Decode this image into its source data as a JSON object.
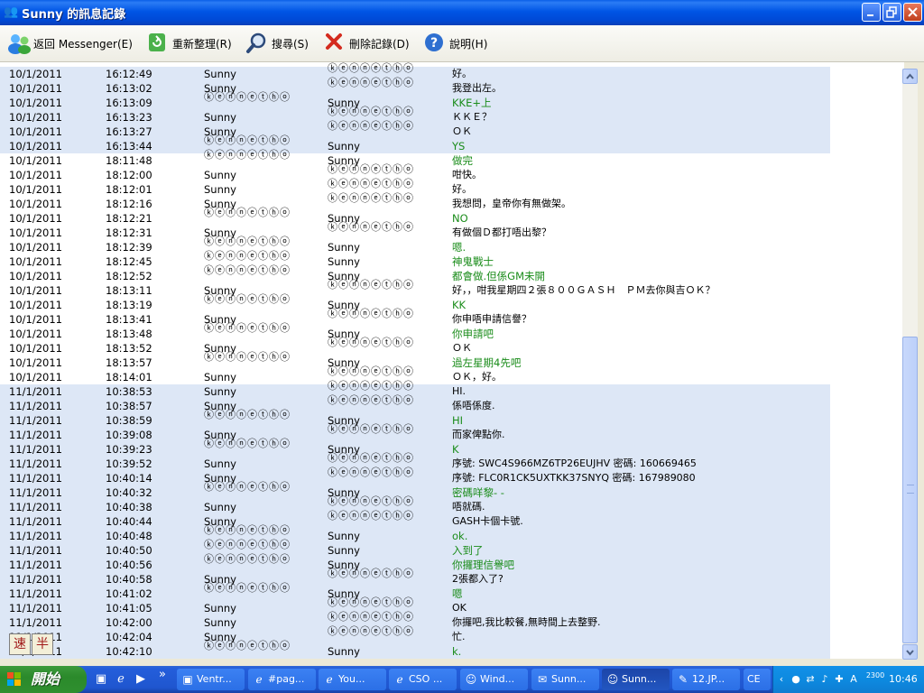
{
  "window": {
    "title": "Sunny 的訊息記錄",
    "icon": "people-icon",
    "controls": [
      "minimize",
      "restore",
      "close"
    ]
  },
  "toolbar": {
    "back_label": "返回 Messenger(E)",
    "refresh_label": "重新整理(R)",
    "search_label": "搜尋(S)",
    "delete_label": "刪除記錄(D)",
    "help_label": "說明(H)"
  },
  "log_rows": [
    {
      "date": "10/1/2011",
      "time": "16:12:49",
      "from": "Sunny",
      "to": "ⓚⓔⓝⓝⓔⓣⓗⓞ",
      "msg": "好。",
      "color": "black",
      "hl": true
    },
    {
      "date": "10/1/2011",
      "time": "16:13:02",
      "from": "Sunny",
      "to": "ⓚⓔⓝⓝⓔⓣⓗⓞ",
      "msg": "我登出左。",
      "color": "black",
      "hl": true
    },
    {
      "date": "10/1/2011",
      "time": "16:13:09",
      "from": "ⓚⓔⓝⓝⓔⓣⓗⓞ",
      "to": "Sunny",
      "msg": "KKE+上",
      "color": "green",
      "hl": true
    },
    {
      "date": "10/1/2011",
      "time": "16:13:23",
      "from": "Sunny",
      "to": "ⓚⓔⓝⓝⓔⓣⓗⓞ",
      "msg": "ＫＫＥ？",
      "color": "black",
      "hl": true
    },
    {
      "date": "10/1/2011",
      "time": "16:13:27",
      "from": "Sunny",
      "to": "ⓚⓔⓝⓝⓔⓣⓗⓞ",
      "msg": "ＯＫ",
      "color": "black",
      "hl": true
    },
    {
      "date": "10/1/2011",
      "time": "16:13:44",
      "from": "ⓚⓔⓝⓝⓔⓣⓗⓞ",
      "to": "Sunny",
      "msg": "YS",
      "color": "green",
      "hl": true
    },
    {
      "date": "10/1/2011",
      "time": "18:11:48",
      "from": "ⓚⓔⓝⓝⓔⓣⓗⓞ",
      "to": "Sunny",
      "msg": "做完",
      "color": "green",
      "hl": false
    },
    {
      "date": "10/1/2011",
      "time": "18:12:00",
      "from": "Sunny",
      "to": "ⓚⓔⓝⓝⓔⓣⓗⓞ",
      "msg": "咁快。",
      "color": "black",
      "hl": false
    },
    {
      "date": "10/1/2011",
      "time": "18:12:01",
      "from": "Sunny",
      "to": "ⓚⓔⓝⓝⓔⓣⓗⓞ",
      "msg": "好。",
      "color": "black",
      "hl": false
    },
    {
      "date": "10/1/2011",
      "time": "18:12:16",
      "from": "Sunny",
      "to": "ⓚⓔⓝⓝⓔⓣⓗⓞ",
      "msg": "我想問，皇帝你有無做架。",
      "color": "black",
      "hl": false
    },
    {
      "date": "10/1/2011",
      "time": "18:12:21",
      "from": "ⓚⓔⓝⓝⓔⓣⓗⓞ",
      "to": "Sunny",
      "msg": "NO",
      "color": "green",
      "hl": false
    },
    {
      "date": "10/1/2011",
      "time": "18:12:31",
      "from": "Sunny",
      "to": "ⓚⓔⓝⓝⓔⓣⓗⓞ",
      "msg": "有做個Ｄ都打唔出黎？",
      "color": "black",
      "hl": false
    },
    {
      "date": "10/1/2011",
      "time": "18:12:39",
      "from": "ⓚⓔⓝⓝⓔⓣⓗⓞ",
      "to": "Sunny",
      "msg": "嗯.",
      "color": "green",
      "hl": false
    },
    {
      "date": "10/1/2011",
      "time": "18:12:45",
      "from": "ⓚⓔⓝⓝⓔⓣⓗⓞ",
      "to": "Sunny",
      "msg": "神鬼戰士",
      "color": "green",
      "hl": false
    },
    {
      "date": "10/1/2011",
      "time": "18:12:52",
      "from": "ⓚⓔⓝⓝⓔⓣⓗⓞ",
      "to": "Sunny",
      "msg": "都會做.但係GM未開",
      "color": "green",
      "hl": false
    },
    {
      "date": "10/1/2011",
      "time": "18:13:11",
      "from": "Sunny",
      "to": "ⓚⓔⓝⓝⓔⓣⓗⓞ",
      "msg": "好，，咁我星期四２張８００ＧＡＳＨ　ＰＭ去你與吉ＯＫ？",
      "color": "black",
      "hl": false
    },
    {
      "date": "10/1/2011",
      "time": "18:13:19",
      "from": "ⓚⓔⓝⓝⓔⓣⓗⓞ",
      "to": "Sunny",
      "msg": "KK",
      "color": "green",
      "hl": false
    },
    {
      "date": "10/1/2011",
      "time": "18:13:41",
      "from": "Sunny",
      "to": "ⓚⓔⓝⓝⓔⓣⓗⓞ",
      "msg": "你申唔申請信譽？",
      "color": "black",
      "hl": false
    },
    {
      "date": "10/1/2011",
      "time": "18:13:48",
      "from": "ⓚⓔⓝⓝⓔⓣⓗⓞ",
      "to": "Sunny",
      "msg": "你申請吧",
      "color": "green",
      "hl": false
    },
    {
      "date": "10/1/2011",
      "time": "18:13:52",
      "from": "Sunny",
      "to": "ⓚⓔⓝⓝⓔⓣⓗⓞ",
      "msg": "ＯＫ",
      "color": "black",
      "hl": false
    },
    {
      "date": "10/1/2011",
      "time": "18:13:57",
      "from": "ⓚⓔⓝⓝⓔⓣⓗⓞ",
      "to": "Sunny",
      "msg": "過左星期4先吧",
      "color": "green",
      "hl": false
    },
    {
      "date": "10/1/2011",
      "time": "18:14:01",
      "from": "Sunny",
      "to": "ⓚⓔⓝⓝⓔⓣⓗⓞ",
      "msg": "ＯＫ，好。",
      "color": "black",
      "hl": false
    },
    {
      "date": "11/1/2011",
      "time": "10:38:53",
      "from": "Sunny",
      "to": "ⓚⓔⓝⓝⓔⓣⓗⓞ",
      "msg": "HI.",
      "color": "black",
      "hl": true
    },
    {
      "date": "11/1/2011",
      "time": "10:38:57",
      "from": "Sunny",
      "to": "ⓚⓔⓝⓝⓔⓣⓗⓞ",
      "msg": "係唔係度.",
      "color": "black",
      "hl": true
    },
    {
      "date": "11/1/2011",
      "time": "10:38:59",
      "from": "ⓚⓔⓝⓝⓔⓣⓗⓞ",
      "to": "Sunny",
      "msg": "HI",
      "color": "green",
      "hl": true
    },
    {
      "date": "11/1/2011",
      "time": "10:39:08",
      "from": "Sunny",
      "to": "ⓚⓔⓝⓝⓔⓣⓗⓞ",
      "msg": "而家俾點你.",
      "color": "black",
      "hl": true
    },
    {
      "date": "11/1/2011",
      "time": "10:39:23",
      "from": "ⓚⓔⓝⓝⓔⓣⓗⓞ",
      "to": "Sunny",
      "msg": "K",
      "color": "green",
      "hl": true
    },
    {
      "date": "11/1/2011",
      "time": "10:39:52",
      "from": "Sunny",
      "to": "ⓚⓔⓝⓝⓔⓣⓗⓞ",
      "msg": "序號: SWC4S966MZ6TP26EUJHV 密碼: 160669465",
      "color": "black",
      "hl": true
    },
    {
      "date": "11/1/2011",
      "time": "10:40:14",
      "from": "Sunny",
      "to": "ⓚⓔⓝⓝⓔⓣⓗⓞ",
      "msg": "序號: FLC0R1CK5UXTKK37SNYQ 密碼: 167989080",
      "color": "black",
      "hl": true
    },
    {
      "date": "11/1/2011",
      "time": "10:40:32",
      "from": "ⓚⓔⓝⓝⓔⓣⓗⓞ",
      "to": "Sunny",
      "msg": "密碼咩黎- -",
      "color": "green",
      "hl": true
    },
    {
      "date": "11/1/2011",
      "time": "10:40:38",
      "from": "Sunny",
      "to": "ⓚⓔⓝⓝⓔⓣⓗⓞ",
      "msg": "唔就碼.",
      "color": "black",
      "hl": true
    },
    {
      "date": "11/1/2011",
      "time": "10:40:44",
      "from": "Sunny",
      "to": "ⓚⓔⓝⓝⓔⓣⓗⓞ",
      "msg": "GASH卡個卡號.",
      "color": "black",
      "hl": true
    },
    {
      "date": "11/1/2011",
      "time": "10:40:48",
      "from": "ⓚⓔⓝⓝⓔⓣⓗⓞ",
      "to": "Sunny",
      "msg": "ok.",
      "color": "green",
      "hl": true
    },
    {
      "date": "11/1/2011",
      "time": "10:40:50",
      "from": "ⓚⓔⓝⓝⓔⓣⓗⓞ",
      "to": "Sunny",
      "msg": "入到了",
      "color": "green",
      "hl": true
    },
    {
      "date": "11/1/2011",
      "time": "10:40:56",
      "from": "ⓚⓔⓝⓝⓔⓣⓗⓞ",
      "to": "Sunny",
      "msg": "你攞理信譽吧",
      "color": "green",
      "hl": true
    },
    {
      "date": "11/1/2011",
      "time": "10:40:58",
      "from": "Sunny",
      "to": "ⓚⓔⓝⓝⓔⓣⓗⓞ",
      "msg": "2張都入了?",
      "color": "black",
      "hl": true
    },
    {
      "date": "11/1/2011",
      "time": "10:41:02",
      "from": "ⓚⓔⓝⓝⓔⓣⓗⓞ",
      "to": "Sunny",
      "msg": "嗯",
      "color": "green",
      "hl": true
    },
    {
      "date": "11/1/2011",
      "time": "10:41:05",
      "from": "Sunny",
      "to": "ⓚⓔⓝⓝⓔⓣⓗⓞ",
      "msg": "OK",
      "color": "black",
      "hl": true
    },
    {
      "date": "11/1/2011",
      "time": "10:42:00",
      "from": "Sunny",
      "to": "ⓚⓔⓝⓝⓔⓣⓗⓞ",
      "msg": "你攞吧,我比較餐,無時間上去整野.",
      "color": "black",
      "hl": true
    },
    {
      "date": "11/1/2011",
      "time": "10:42:04",
      "from": "Sunny",
      "to": "ⓚⓔⓝⓝⓔⓣⓗⓞ",
      "msg": "忙.",
      "color": "black",
      "hl": true
    },
    {
      "date": "11/1/2011",
      "time": "10:42:10",
      "from": "ⓚⓔⓝⓝⓔⓣⓗⓞ",
      "to": "Sunny",
      "msg": "k.",
      "color": "green",
      "hl": true
    }
  ],
  "ime": {
    "speed_label": "速",
    "half_label": "半"
  },
  "taskbar": {
    "start_label": "開始",
    "tasks": [
      {
        "label": "Ventr...",
        "icon": "ventrilo-icon",
        "active": false
      },
      {
        "label": "#pag...",
        "icon": "ie-icon",
        "active": false
      },
      {
        "label": "You...",
        "icon": "ie-icon",
        "active": false
      },
      {
        "label": "CSO ...",
        "icon": "ie-icon",
        "active": false
      },
      {
        "label": "Wind...",
        "icon": "messenger-icon",
        "active": false
      },
      {
        "label": "Sunn...",
        "icon": "chat-icon",
        "active": false
      },
      {
        "label": "Sunn...",
        "icon": "messenger-icon",
        "active": true
      },
      {
        "label": "12.JP...",
        "icon": "paint-icon",
        "active": false
      },
      {
        "label": "CE",
        "icon": "",
        "active": false
      }
    ],
    "tray_badge": "2300",
    "clock": "10:46"
  },
  "colors": {
    "titlebar": "#0055e5",
    "row_highlight": "#dde7f6",
    "message_green": "#1a8c1a",
    "taskbar": "#245edb",
    "start_button": "#2b8a2b"
  }
}
